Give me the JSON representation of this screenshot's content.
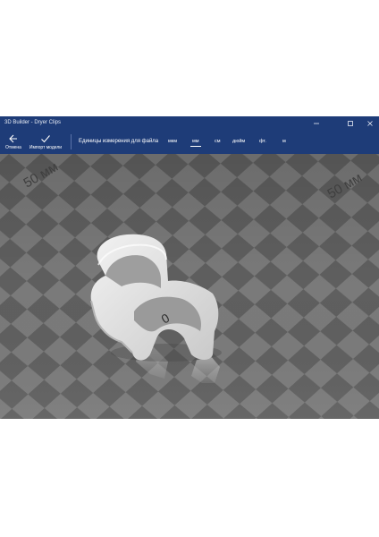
{
  "window": {
    "title": "3D Builder - Dryer Clips",
    "controls": {
      "minimize": "—",
      "maximize": "☐",
      "close": "✕"
    }
  },
  "toolbar": {
    "cancel_label": "Отмена",
    "import_label": "Импорт модели",
    "units_label": "Единицы измерения для файла",
    "units": [
      "мкм",
      "мм",
      "см",
      "дюйм",
      "фт.",
      "м"
    ],
    "selected_unit": "мм"
  },
  "scene": {
    "scale_label_left": "50 мм",
    "scale_label_right": "50 мм",
    "origin_label": "0"
  },
  "colors": {
    "accent": "#1e3c78",
    "floor_dark": "#5f5f5f",
    "floor_light": "#7a7a7a",
    "model": "#e4e4e4"
  }
}
